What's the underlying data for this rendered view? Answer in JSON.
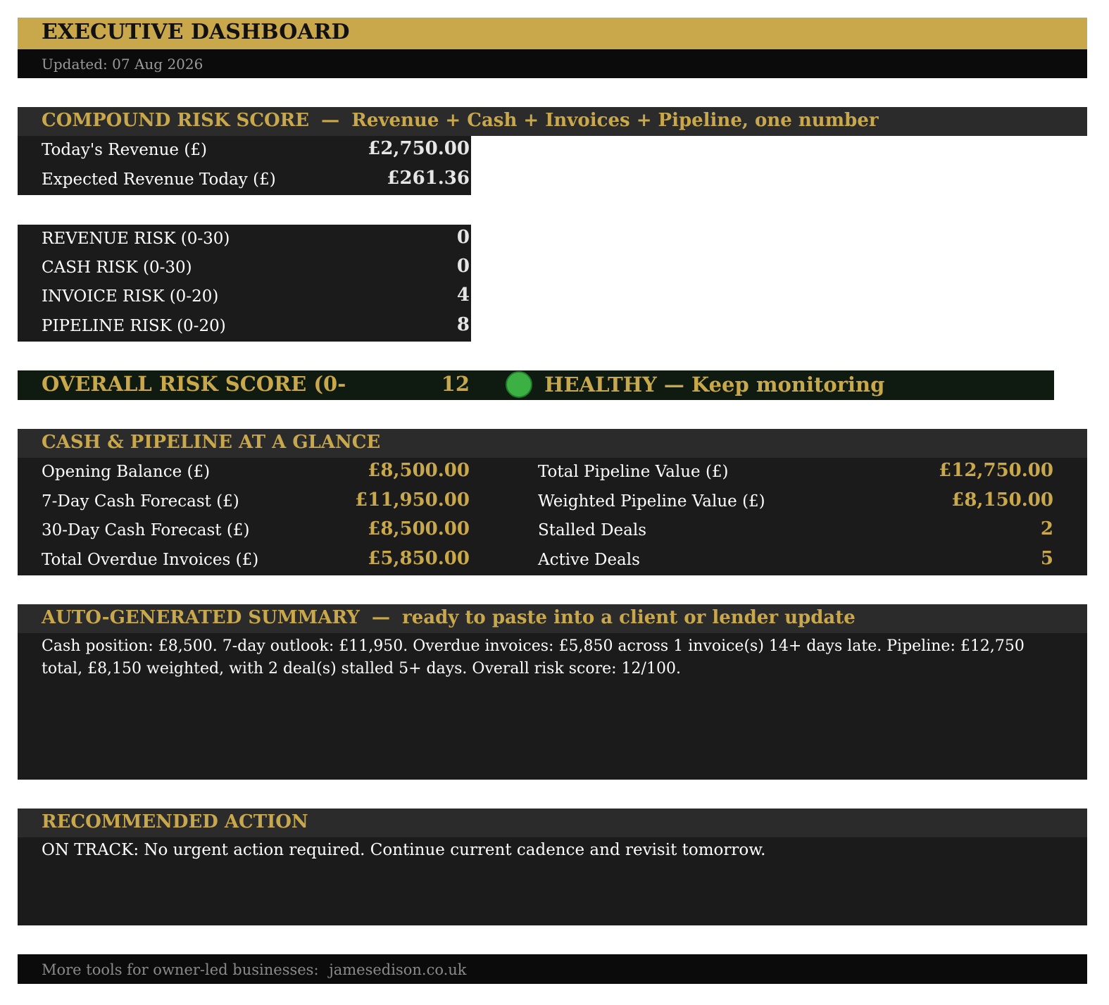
{
  "header": {
    "title": "EXECUTIVE DASHBOARD",
    "updated": "Updated: 07 Aug 2026"
  },
  "compound": {
    "title": "COMPOUND RISK SCORE",
    "separator": "—",
    "subtitle": "Revenue + Cash + Invoices + Pipeline, one number",
    "rows": [
      {
        "label": "Today's Revenue (£)",
        "value": "£2,750.00"
      },
      {
        "label": "Expected Revenue Today (£)",
        "value": "£261.36"
      }
    ]
  },
  "risks": [
    {
      "label": "REVENUE RISK (0-30)",
      "value": "0"
    },
    {
      "label": "CASH RISK (0-30)",
      "value": "0"
    },
    {
      "label": "INVOICE RISK (0-20)",
      "value": "4"
    },
    {
      "label": "PIPELINE RISK (0-20)",
      "value": "8"
    }
  ],
  "overall": {
    "label": "OVERALL RISK SCORE (0-",
    "value": "12",
    "status_icon": "green-circle-icon",
    "status": "HEALTHY — Keep monitoring",
    "status_color": "#3cb043"
  },
  "glance": {
    "title": "CASH & PIPELINE AT A GLANCE",
    "left": [
      {
        "label": "Opening Balance (£)",
        "value": "£8,500.00"
      },
      {
        "label": "7-Day Cash Forecast (£)",
        "value": "£11,950.00"
      },
      {
        "label": "30-Day Cash Forecast (£)",
        "value": "£8,500.00"
      },
      {
        "label": "Total Overdue Invoices (£)",
        "value": "£5,850.00"
      }
    ],
    "right": [
      {
        "label": "Total Pipeline Value (£)",
        "value": "£12,750.00"
      },
      {
        "label": "Weighted Pipeline Value (£)",
        "value": "£8,150.00"
      },
      {
        "label": "Stalled Deals",
        "value": "2"
      },
      {
        "label": "Active Deals",
        "value": "5"
      }
    ]
  },
  "summary": {
    "title": "AUTO-GENERATED SUMMARY",
    "separator": "—",
    "subtitle": "ready to paste into a client or lender update",
    "text": "Cash position: £8,500. 7-day outlook: £11,950. Overdue invoices: £5,850 across 1 invoice(s) 14+ days late. Pipeline: £12,750 total, £8,150 weighted, with 2 deal(s) stalled 5+ days. Overall risk score: 12/100."
  },
  "action": {
    "title": "RECOMMENDED ACTION",
    "text": "ON TRACK: No urgent action required. Continue current cadence and revisit tomorrow."
  },
  "footer": {
    "text": "More tools for owner-led businesses:",
    "link": "jamesedison.co.uk"
  },
  "colors": {
    "accent": "#c9a84c",
    "panel": "#1b1b1b",
    "header_bar": "#2b2b2b",
    "top_bar": "#0b0b0b",
    "overall_bg": "#0f1a10"
  }
}
